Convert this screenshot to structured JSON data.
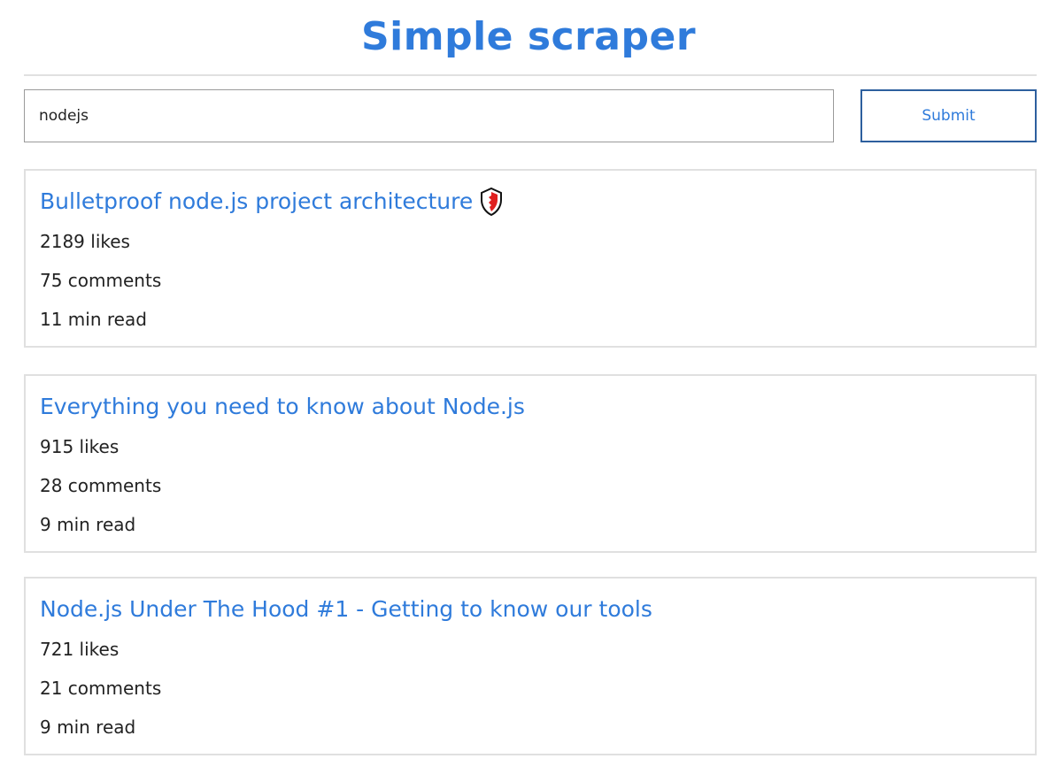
{
  "header": {
    "title": "Simple scraper"
  },
  "search": {
    "value": "nodejs",
    "submit_label": "Submit"
  },
  "articles": [
    {
      "title": "Bulletproof node.js project architecture",
      "title_icon": "shield-icon",
      "likes": "2189 likes",
      "comments": "75 comments",
      "read_time": "11 min read"
    },
    {
      "title": "Everything you need to know about Node.js",
      "likes": "915 likes",
      "comments": "28 comments",
      "read_time": "9 min read"
    },
    {
      "title": "Node.js Under The Hood #1 - Getting to know our tools",
      "likes": "721 likes",
      "comments": "21 comments",
      "read_time": "9 min read"
    }
  ],
  "colors": {
    "accent": "#2f7bdb",
    "button_border": "#2d5f9e",
    "card_border": "#e0e0e0",
    "text": "#222222"
  }
}
